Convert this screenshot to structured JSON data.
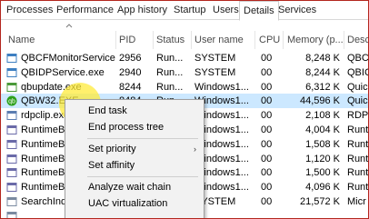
{
  "tabs": [
    "Processes",
    "Performance",
    "App history",
    "Startup",
    "Users",
    "Details",
    "Services"
  ],
  "active_tab": "Details",
  "columns": [
    "Name",
    "PID",
    "Status",
    "User name",
    "CPU",
    "Memory (p...",
    "Desc"
  ],
  "rows": [
    {
      "name": "QBCFMonitorService...",
      "pid": "2956",
      "status": "Run...",
      "user": "SYSTEM",
      "cpu": "00",
      "memory": "8,248 K",
      "desc": "QBC"
    },
    {
      "name": "QBIDPService.exe",
      "pid": "2940",
      "status": "Run...",
      "user": "SYSTEM",
      "cpu": "00",
      "memory": "8,244 K",
      "desc": "QBIC"
    },
    {
      "name": "qbupdate.exe",
      "pid": "8244",
      "status": "Run...",
      "user": "Windows1...",
      "cpu": "00",
      "memory": "6,312 K",
      "desc": "Quic"
    },
    {
      "name": "QBW32.EXE",
      "pid": "8484",
      "status": "Run...",
      "user": "Windows1...",
      "cpu": "00",
      "memory": "44,596 K",
      "desc": "Quic"
    },
    {
      "name": "rdpclip.exe",
      "pid": "",
      "status": "",
      "user": "Windows1...",
      "cpu": "00",
      "memory": "2,108 K",
      "desc": "RDP"
    },
    {
      "name": "RuntimeBr",
      "pid": "",
      "status": "",
      "user": "Windows1...",
      "cpu": "00",
      "memory": "4,004 K",
      "desc": "Runt"
    },
    {
      "name": "RuntimeBr",
      "pid": "",
      "status": "",
      "user": "Windows1...",
      "cpu": "00",
      "memory": "1,508 K",
      "desc": "Runt"
    },
    {
      "name": "RuntimeBr",
      "pid": "",
      "status": "",
      "user": "Windows1...",
      "cpu": "00",
      "memory": "1,120 K",
      "desc": "Runt"
    },
    {
      "name": "RuntimeBr",
      "pid": "",
      "status": "",
      "user": "Windows1...",
      "cpu": "00",
      "memory": "1,500 K",
      "desc": "Runt"
    },
    {
      "name": "RuntimeBr",
      "pid": "",
      "status": "",
      "user": "Windows1...",
      "cpu": "00",
      "memory": "4,096 K",
      "desc": "Runt"
    },
    {
      "name": "SearchInde",
      "pid": "",
      "status": "",
      "user": "SYSTEM",
      "cpu": "00",
      "memory": "21,572 K",
      "desc": "Micr"
    },
    {
      "name": "",
      "pid": "",
      "status": "",
      "user": "",
      "cpu": "",
      "memory": "",
      "desc": ""
    }
  ],
  "context_menu": {
    "end_task": "End task",
    "end_process_tree": "End process tree",
    "set_priority": "Set priority",
    "set_affinity": "Set affinity",
    "analyze_wait_chain": "Analyze wait chain",
    "uac_virtualization": "UAC virtualization",
    "submenu_arrow": "›"
  },
  "colors": {
    "selected_row": "#cce8ff",
    "menu_bg": "#f2f2f2",
    "border_accent": "#b3261e",
    "highlight": "#ffeb3b"
  }
}
